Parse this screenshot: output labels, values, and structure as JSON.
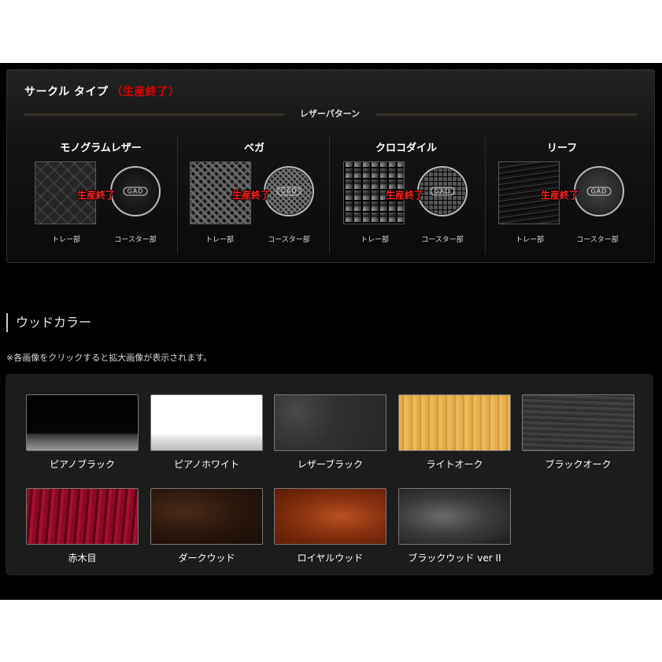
{
  "circle_type": {
    "title": "サークル タイプ",
    "discontinued_note": "（生産終了）",
    "pattern_label": "レザーパターン",
    "stamp": "生産終了",
    "tray_caption": "トレー部",
    "coaster_caption": "コースター部",
    "coaster_logo": "GAD",
    "leathers": [
      {
        "name": "モノグラムレザー"
      },
      {
        "name": "ベガ"
      },
      {
        "name": "クロコダイル"
      },
      {
        "name": "リーフ"
      }
    ]
  },
  "wood": {
    "heading": "ウッドカラー",
    "note": "※各画像をクリックすると拡大画像が表示されます。",
    "colors": [
      {
        "label": "ピアノブラック"
      },
      {
        "label": "ピアノホワイト"
      },
      {
        "label": "レザーブラック"
      },
      {
        "label": "ライトオーク"
      },
      {
        "label": "ブラックオーク"
      },
      {
        "label": "赤木目"
      },
      {
        "label": "ダークウッド"
      },
      {
        "label": "ロイヤルウッド"
      },
      {
        "label": "ブラックウッド ver II"
      }
    ]
  }
}
